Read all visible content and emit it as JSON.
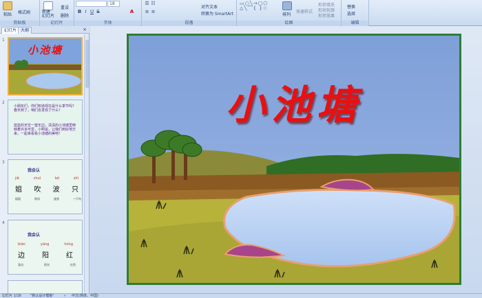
{
  "ribbon": {
    "clipboard": {
      "paste": "粘贴",
      "format_painter": "格式刷",
      "label": "剪贴板"
    },
    "slides": {
      "new_slide": "新建\n幻灯片",
      "reset": "重设",
      "delete": "删除",
      "label": "幻灯片"
    },
    "font": {
      "size": "18",
      "label": "字体"
    },
    "paragraph": {
      "align_text": "对齐文本",
      "convert_smartart": "转换为 SmartArt",
      "label": "段落"
    },
    "drawing": {
      "arrange": "排列",
      "quick_styles": "快速样式",
      "shape_fill": "形状填充",
      "shape_outline": "形状轮廓",
      "shape_effects": "形状效果",
      "label": "绘图"
    },
    "editing": {
      "replace": "替换",
      "select": "选择",
      "label": "编辑"
    }
  },
  "pane": {
    "tabs": [
      "幻灯片",
      "大纲"
    ],
    "thumbs": [
      {
        "num": "1",
        "title": "小池塘"
      },
      {
        "num": "2",
        "text1": "小朋友们，你们知道现在是什么季节吗？春天到了，咱们去发现了什么？",
        "text2": "蓝蓝的天空一望无边，清清的小池塘里倒映着许多可爱，小明说，让我们到好地方来，一起来看看小池塘的美吧！"
      },
      {
        "num": "3",
        "heading": "我会认",
        "pinyin": [
          "jiě",
          "chuī",
          "bō",
          "zhī"
        ],
        "chars": [
          "姐",
          "吹",
          "波",
          "只"
        ],
        "words": [
          "姐姐",
          "吹风",
          "波浪",
          "一只鸟"
        ]
      },
      {
        "num": "4",
        "heading": "我会认",
        "pinyin": [
          "biān",
          "yáng",
          "hóng"
        ],
        "chars": [
          "边",
          "阳",
          "红"
        ],
        "words": [
          "身边",
          "阳光",
          "红色"
        ]
      }
    ]
  },
  "slide": {
    "title": "小池塘"
  },
  "status": {
    "slide_info": "幻灯片 1/16",
    "theme": "\"默认设计模板\"",
    "language": "中文(简体，中国)"
  }
}
